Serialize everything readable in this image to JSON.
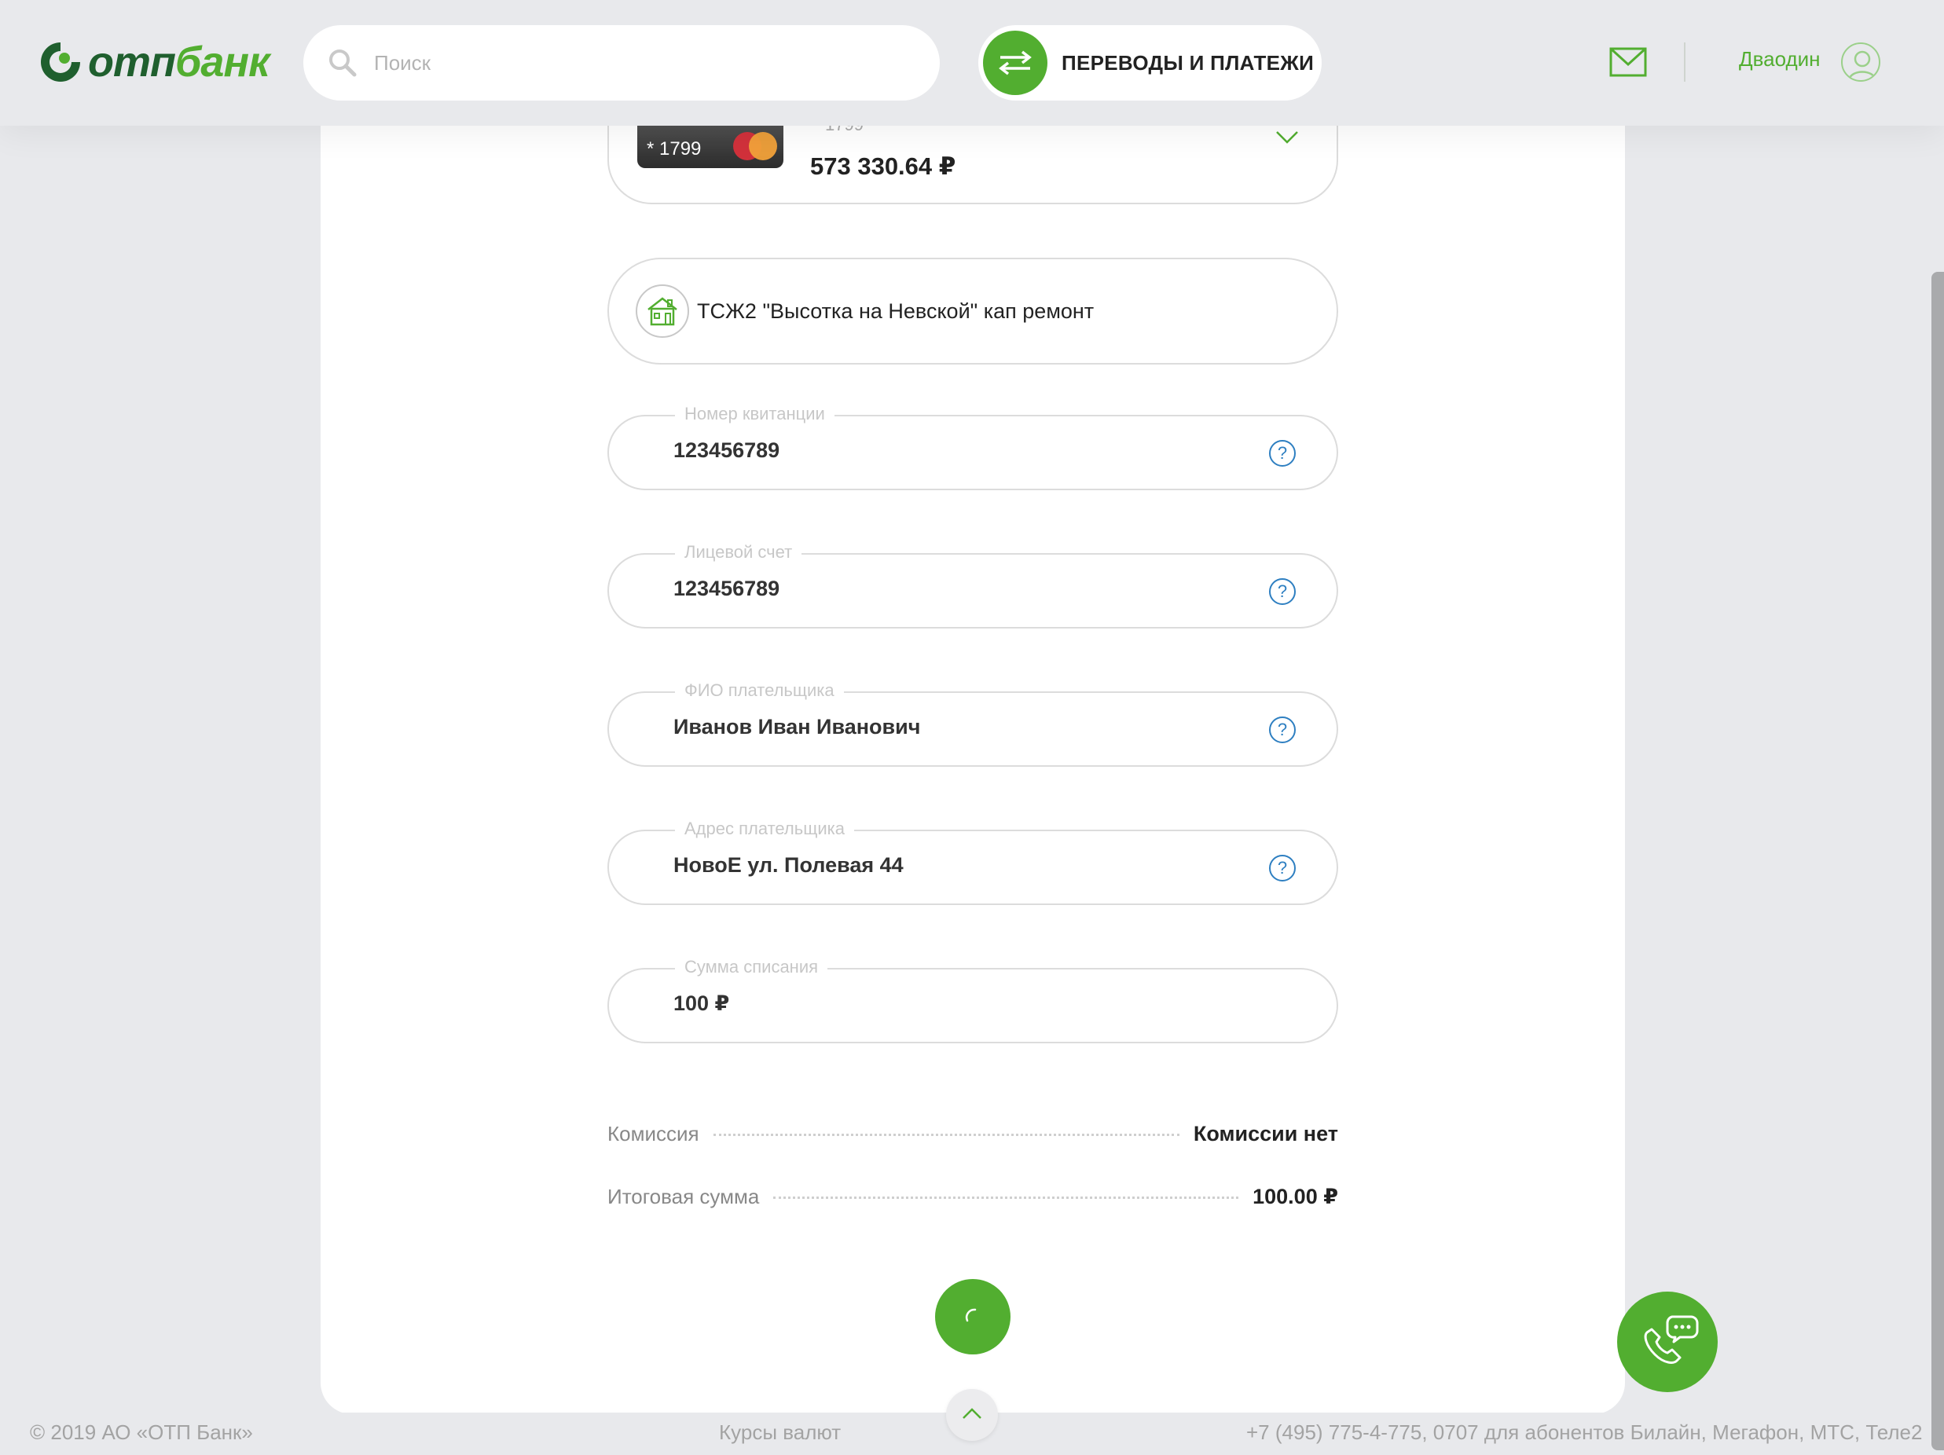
{
  "header": {
    "logo_prefix": "отп",
    "logo_suffix": "банк",
    "search_placeholder": "Поиск",
    "transfers_label": "ПЕРЕВОДЫ И ПЛАТЕЖИ",
    "user_name": "Дваодин"
  },
  "card_selector": {
    "card_number_short": "* 1799",
    "card_number_faint": "1799",
    "balance": "573 330.64 ₽"
  },
  "recipient": {
    "name": "ТСЖ2 \"Высотка на Невской\" кап ремонт"
  },
  "fields": [
    {
      "label": "Номер квитанции",
      "value": "123456789",
      "help": "?"
    },
    {
      "label": "Лицевой счет",
      "value": "123456789",
      "help": "?"
    },
    {
      "label": "ФИО плательщика",
      "value": "Иванов Иван Иванович",
      "help": "?"
    },
    {
      "label": "Адрес плательщика",
      "value": "НовоЕ ул. Полевая 44",
      "help": "?"
    },
    {
      "label": "Сумма списания",
      "value": "100 ₽"
    }
  ],
  "summary": {
    "commission_label": "Комиссия",
    "commission_value": "Комиссии нет",
    "total_label": "Итоговая сумма",
    "total_value": "100.00 ₽"
  },
  "footer": {
    "copyright": "© 2019 АО «ОТП Банк»",
    "rates_link": "Курсы валют",
    "phone": "+7 (495) 775-4-775,  0707 для абонентов Билайн, Мегафон, МТС, Теле2"
  },
  "colors": {
    "brand_green": "#52ae30",
    "brand_dark_green": "#1f5f2e",
    "help_blue": "#2e7fc1",
    "background": "#e8e9ec"
  },
  "icons": [
    "search-icon",
    "transfer-arrows-icon",
    "mail-icon",
    "user-avatar-icon",
    "chevron-down-icon",
    "house-icon",
    "help-icon",
    "spinner-icon",
    "phone-chat-icon",
    "chevron-up-icon"
  ]
}
